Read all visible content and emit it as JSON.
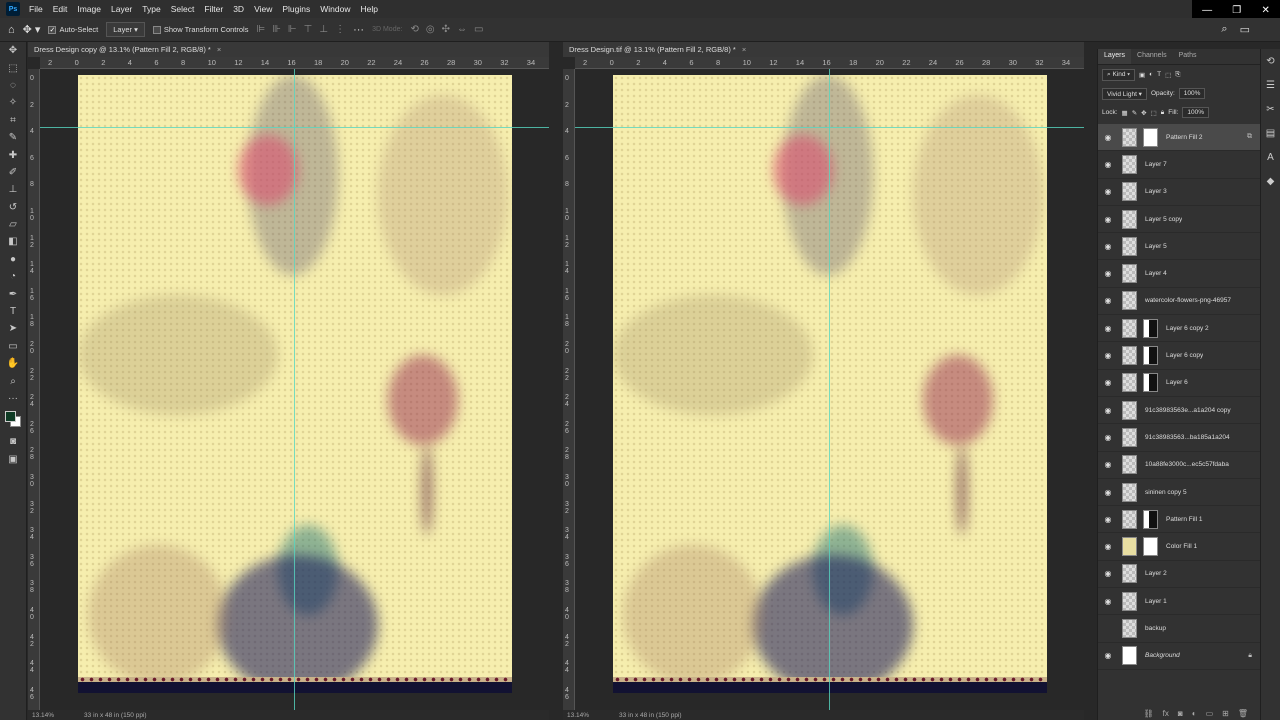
{
  "menubar": {
    "logo": "Ps",
    "items": [
      "File",
      "Edit",
      "Image",
      "Layer",
      "Type",
      "Select",
      "Filter",
      "3D",
      "View",
      "Plugins",
      "Window",
      "Help"
    ],
    "window_controls": [
      "—",
      "❐",
      "✕"
    ]
  },
  "options": {
    "auto_select_label": "Auto-Select",
    "target_value": "Layer",
    "transform_controls_label": "Show Transform Controls",
    "mode_3d_label": "3D Mode:"
  },
  "documents": [
    {
      "tab_title": "Dress Design copy @ 13.1% (Pattern Fill 2, RGB/8) *",
      "zoom": "13.14%",
      "size_info": "33 in x 48 in (150 ppi)"
    },
    {
      "tab_title": "Dress Design.tif @ 13.1% (Pattern Fill 2, RGB/8) *",
      "zoom": "13.14%",
      "size_info": "33 in x 48 in (150 ppi)"
    }
  ],
  "ruler": {
    "h_labels": [
      "2",
      "0",
      "2",
      "4",
      "6",
      "8",
      "10",
      "12",
      "14",
      "16",
      "18",
      "20",
      "22",
      "24",
      "26",
      "28",
      "30",
      "32",
      "34"
    ],
    "v_labels": [
      "0",
      "2",
      "4",
      "6",
      "8",
      "1 0",
      "1 2",
      "1 4",
      "1 6",
      "1 8",
      "2 0",
      "2 2",
      "2 4",
      "2 6",
      "2 8",
      "3 0",
      "3 2",
      "3 4",
      "3 6",
      "3 8",
      "4 0",
      "4 2",
      "4 4",
      "4 6"
    ]
  },
  "layers_panel": {
    "tabs": [
      "Layers",
      "Channels",
      "Paths"
    ],
    "filter_kind": "Kind",
    "blend_mode": "Vivid Light",
    "opacity_label": "Opacity:",
    "opacity_value": "100%",
    "lock_label": "Lock:",
    "fill_label": "Fill:",
    "fill_value": "100%",
    "layers": [
      {
        "name": "Pattern Fill 2",
        "visible": true,
        "selected": true,
        "mask": "white"
      },
      {
        "name": "Layer 7",
        "visible": true
      },
      {
        "name": "Layer 3",
        "visible": true
      },
      {
        "name": "Layer 5 copy",
        "visible": true
      },
      {
        "name": "Layer 5",
        "visible": true
      },
      {
        "name": "Layer 4",
        "visible": true
      },
      {
        "name": "watercolor-flowers-png-46957",
        "visible": true
      },
      {
        "name": "Layer 6 copy 2",
        "visible": true,
        "mask": "dark"
      },
      {
        "name": "Layer 6 copy",
        "visible": true,
        "mask": "dark"
      },
      {
        "name": "Layer 6",
        "visible": true,
        "mask": "dark"
      },
      {
        "name": "91c38983563e...a1a204 copy",
        "visible": true
      },
      {
        "name": "91c38983563...ba185a1a204",
        "visible": true
      },
      {
        "name": "10a88fe3000c...ec5c57fdaba",
        "visible": true
      },
      {
        "name": "sininen copy 5",
        "visible": true
      },
      {
        "name": "Pattern Fill 1",
        "visible": true,
        "mask": "dark"
      },
      {
        "name": "Color Fill 1",
        "visible": true,
        "thumb": "solid-yellow",
        "mask": "white"
      },
      {
        "name": "Layer 2",
        "visible": true
      },
      {
        "name": "Layer 1",
        "visible": true
      },
      {
        "name": "backup",
        "visible": false
      },
      {
        "name": "Background",
        "visible": true,
        "thumb": "white",
        "locked": true,
        "italic": true
      }
    ]
  },
  "colors": {
    "canvas": "#f6eeae",
    "guide": "#56d6c0",
    "foreground": "#0f3b25",
    "background": "#ffffff"
  }
}
